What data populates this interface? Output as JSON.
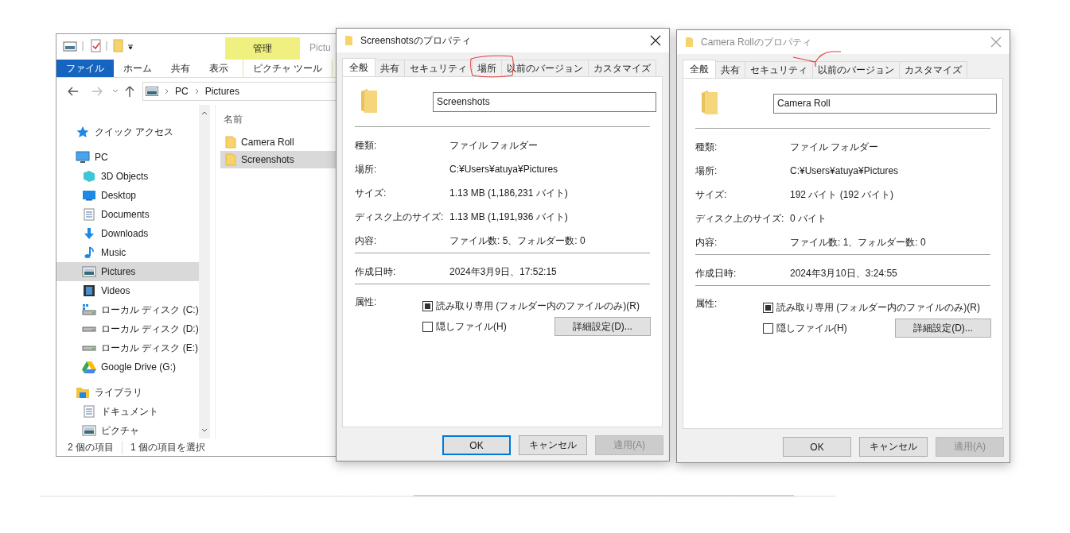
{
  "explorer": {
    "title_partial": "Pictu",
    "context_group": "管理",
    "ribbon_tabs": [
      {
        "label": "ファイル",
        "kind": "file"
      },
      {
        "label": "ホーム",
        "kind": "tab"
      },
      {
        "label": "共有",
        "kind": "tab"
      },
      {
        "label": "表示",
        "kind": "tab"
      },
      {
        "label": "ピクチャ ツール",
        "kind": "context"
      }
    ],
    "address": [
      "PC",
      "Pictures"
    ],
    "nav": [
      {
        "label": "クイック アクセス",
        "kind": "star",
        "selected": false
      },
      {
        "label": "PC",
        "kind": "pc",
        "selected": false,
        "children": [
          {
            "label": "3D Objects",
            "kind": "cube",
            "selected": false
          },
          {
            "label": "Desktop",
            "kind": "desktop",
            "selected": false
          },
          {
            "label": "Documents",
            "kind": "doc",
            "selected": false
          },
          {
            "label": "Downloads",
            "kind": "download",
            "selected": false
          },
          {
            "label": "Music",
            "kind": "music",
            "selected": false
          },
          {
            "label": "Pictures",
            "kind": "pictures",
            "selected": true
          },
          {
            "label": "Videos",
            "kind": "videos",
            "selected": false
          },
          {
            "label": "ローカル ディスク (C:)",
            "kind": "drive-win",
            "selected": false
          },
          {
            "label": "ローカル ディスク (D:)",
            "kind": "drive",
            "selected": false
          },
          {
            "label": "ローカル ディスク (E:)",
            "kind": "drive",
            "selected": false
          },
          {
            "label": "Google Drive (G:)",
            "kind": "gdrive",
            "selected": false
          }
        ]
      },
      {
        "label": "ライブラリ",
        "kind": "library",
        "selected": false,
        "children": [
          {
            "label": "ドキュメント",
            "kind": "doc",
            "selected": false
          },
          {
            "label": "ピクチャ",
            "kind": "pictures",
            "selected": false
          }
        ]
      }
    ],
    "column": "名前",
    "files": [
      {
        "name": "Camera Roll",
        "selected": false
      },
      {
        "name": "Screenshots",
        "selected": true
      }
    ],
    "status": [
      "2 個の項目",
      "1 個の項目を選択"
    ]
  },
  "dialogs": [
    {
      "title": "Screenshotsのプロパティ",
      "active": true,
      "annotation": {
        "kind": "circle"
      },
      "tabs": [
        {
          "label": "全般",
          "selected": true
        },
        {
          "label": "共有",
          "selected": false
        },
        {
          "label": "セキュリティ",
          "selected": false
        },
        {
          "label": "場所",
          "selected": false
        },
        {
          "label": "以前のバージョン",
          "selected": false
        },
        {
          "label": "カスタマイズ",
          "selected": false
        }
      ],
      "name": "Screenshots",
      "rows": [
        {
          "label": "種類:",
          "value": "ファイル フォルダー"
        },
        {
          "label": "場所:",
          "value": "C:¥Users¥atuya¥Pictures"
        },
        {
          "label": "サイズ:",
          "value": "1.13 MB (1,186,231 バイト)"
        },
        {
          "label": "ディスク上のサイズ:",
          "value": "1.13 MB (1,191,936 バイト)"
        },
        {
          "label": "内容:",
          "value": "ファイル数: 5、フォルダー数: 0"
        }
      ],
      "created": {
        "label": "作成日時:",
        "value": "2024年3月9日、17:52:15"
      },
      "attributes_label": "属性:",
      "checkboxes": [
        {
          "label": "読み取り専用 (フォルダー内のファイルのみ)(R)",
          "checked": false,
          "indeterminate": true
        },
        {
          "label": "隠しファイル(H)",
          "checked": false,
          "indeterminate": false
        }
      ],
      "advanced": "詳細設定(D)...",
      "buttons": [
        {
          "label": "OK",
          "focused": true,
          "disabled": false
        },
        {
          "label": "キャンセル",
          "focused": false,
          "disabled": false
        },
        {
          "label": "適用(A)",
          "focused": false,
          "disabled": true
        }
      ]
    },
    {
      "title": "Camera Rollのプロパティ",
      "active": false,
      "annotation": {
        "kind": "stroke"
      },
      "tabs": [
        {
          "label": "全般",
          "selected": true
        },
        {
          "label": "共有",
          "selected": false
        },
        {
          "label": "セキュリティ",
          "selected": false
        },
        {
          "label": "以前のバージョン",
          "selected": false
        },
        {
          "label": "カスタマイズ",
          "selected": false
        }
      ],
      "name": "Camera Roll",
      "rows": [
        {
          "label": "種類:",
          "value": "ファイル フォルダー"
        },
        {
          "label": "場所:",
          "value": "C:¥Users¥atuya¥Pictures"
        },
        {
          "label": "サイズ:",
          "value": "192 バイト (192 バイト)"
        },
        {
          "label": "ディスク上のサイズ:",
          "value": "0 バイト"
        },
        {
          "label": "内容:",
          "value": "ファイル数: 1、フォルダー数: 0"
        }
      ],
      "created": {
        "label": "作成日時:",
        "value": "2024年3月10日、3:24:55"
      },
      "attributes_label": "属性:",
      "checkboxes": [
        {
          "label": "読み取り専用 (フォルダー内のファイルのみ)(R)",
          "checked": false,
          "indeterminate": true
        },
        {
          "label": "隠しファイル(H)",
          "checked": false,
          "indeterminate": false
        }
      ],
      "advanced": "詳細設定(D)...",
      "buttons": [
        {
          "label": "OK",
          "focused": false,
          "disabled": false
        },
        {
          "label": "キャンセル",
          "focused": false,
          "disabled": false
        },
        {
          "label": "適用(A)",
          "focused": false,
          "disabled": true
        }
      ]
    }
  ]
}
